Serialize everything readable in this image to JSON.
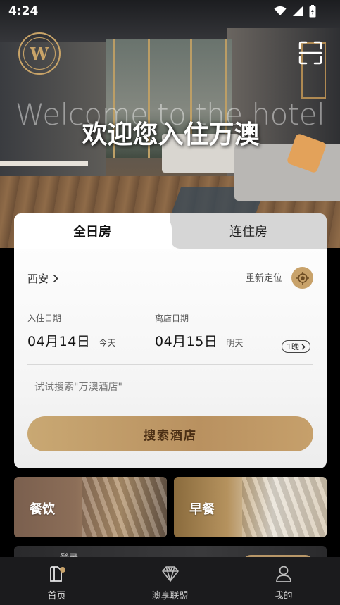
{
  "status_bar": {
    "time": "4:24"
  },
  "hero": {
    "logo_letter": "W",
    "welcome_en": "Welcome to the hotel",
    "welcome_zh": "欢迎您入住万澳"
  },
  "booking": {
    "tabs": [
      {
        "label": "全日房",
        "active": true
      },
      {
        "label": "连住房",
        "active": false
      }
    ],
    "city": "西安",
    "relocate_label": "重新定位",
    "checkin": {
      "label": "入住日期",
      "date": "04月14日",
      "relative": "今天"
    },
    "checkout": {
      "label": "离店日期",
      "date": "04月15日",
      "relative": "明天"
    },
    "nights": "1晚",
    "search_placeholder": "试试搜索\"万澳酒店\"",
    "search_button": "搜索酒店"
  },
  "tiles": [
    {
      "label": "餐饮"
    },
    {
      "label": "早餐"
    }
  ],
  "peek": {
    "text": "登录"
  },
  "bottom_nav": [
    {
      "label": "首页",
      "icon": "home-icon",
      "active": true
    },
    {
      "label": "澳享联盟",
      "icon": "diamond-icon",
      "active": false
    },
    {
      "label": "我的",
      "icon": "person-icon",
      "active": false
    }
  ],
  "colors": {
    "gold": "#c8a26a",
    "nav_bg": "#1b1b1d"
  }
}
